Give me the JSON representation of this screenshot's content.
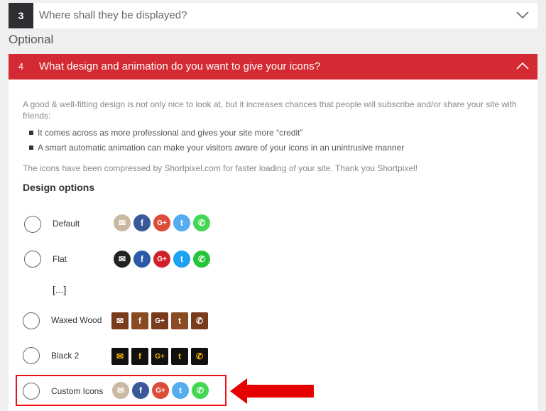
{
  "step3": {
    "number": "3",
    "title": "Where shall they be displayed?"
  },
  "optional_label": "Optional",
  "step4": {
    "number": "4",
    "title": "What design and animation do you want to give your icons?"
  },
  "intro": "A good & well-fitting design is not only nice to look at, but it increases chances that people will subscribe and/or share your site with friends:",
  "bullets": [
    "It comes across as more professional and gives your site more “credit”",
    "A smart automatic animation can make your visitors aware of your icons in an unintrusive manner"
  ],
  "compressed_note": "The icons have been compressed by Shortpixel.com for faster loading of your site. Thank you Shortpixel!",
  "design_options_heading": "Design options",
  "ellipsis": "[...]",
  "options": [
    {
      "label": "Default"
    },
    {
      "label": "Flat"
    },
    {
      "label": "Waxed Wood"
    },
    {
      "label": "Black 2"
    },
    {
      "label": "Custom Icons"
    }
  ],
  "colors": {
    "accent_red": "#d42a33",
    "dark": "#2e2f33",
    "highlight": "#e11111"
  },
  "icon_set": [
    "email-icon",
    "facebook-icon",
    "google-plus-icon",
    "twitter-icon",
    "whatsapp-icon"
  ]
}
